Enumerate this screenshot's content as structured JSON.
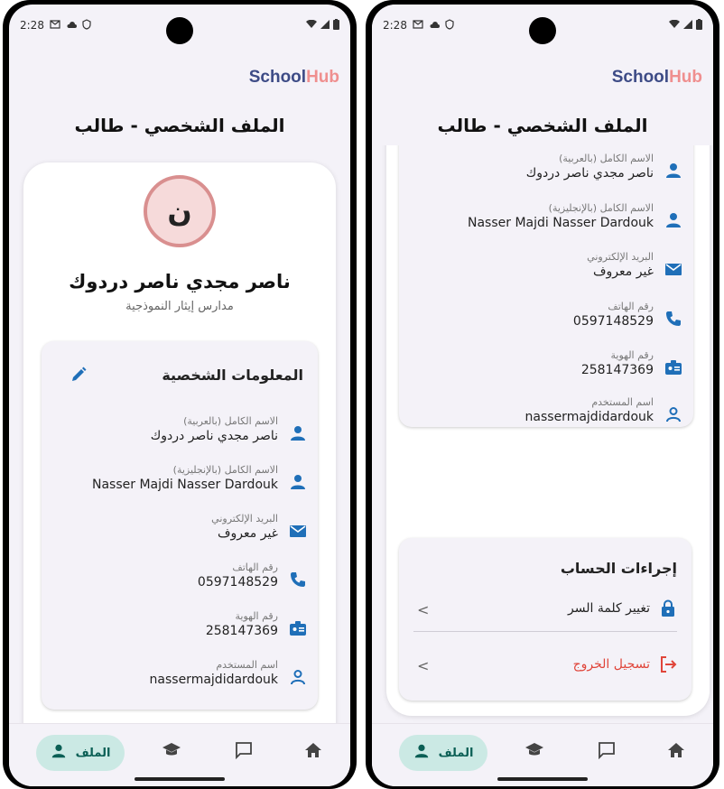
{
  "status": {
    "time": "2:28"
  },
  "brand": {
    "school": "School",
    "hub": "Hub"
  },
  "page_title": "الملف الشخصي - طالب",
  "profile": {
    "avatar_letter": "ن",
    "name": "ناصر مجدي ناصر دردوك",
    "school": "مدارس إيثار النموذجية"
  },
  "info": {
    "heading": "المعلومات الشخصية",
    "rows": [
      {
        "label": "الاسم الكامل (بالعربية)",
        "value": "ناصر مجدي ناصر دردوك",
        "icon": "person-icon"
      },
      {
        "label": "الاسم الكامل (بالإنجليزية)",
        "value": "Nasser Majdi Nasser Dardouk",
        "icon": "person-icon"
      },
      {
        "label": "البريد الإلكتروني",
        "value": "غير معروف",
        "icon": "email-icon"
      },
      {
        "label": "رقم الهاتف",
        "value": "0597148529",
        "icon": "phone-icon"
      },
      {
        "label": "رقم الهوية",
        "value": "258147369",
        "icon": "id-badge-icon"
      },
      {
        "label": "اسم المستخدم",
        "value": "nassermajdidardouk",
        "icon": "user-outline-icon"
      }
    ]
  },
  "actions": {
    "title": "إجراءات الحساب",
    "change_password": "تغيير كلمة السر",
    "logout": "تسجيل الخروج",
    "logout_color": "#e0453a"
  },
  "nav": {
    "profile_label": "الملف",
    "accent": "#1f6fb8",
    "active_bg": "#cbe9e4"
  }
}
